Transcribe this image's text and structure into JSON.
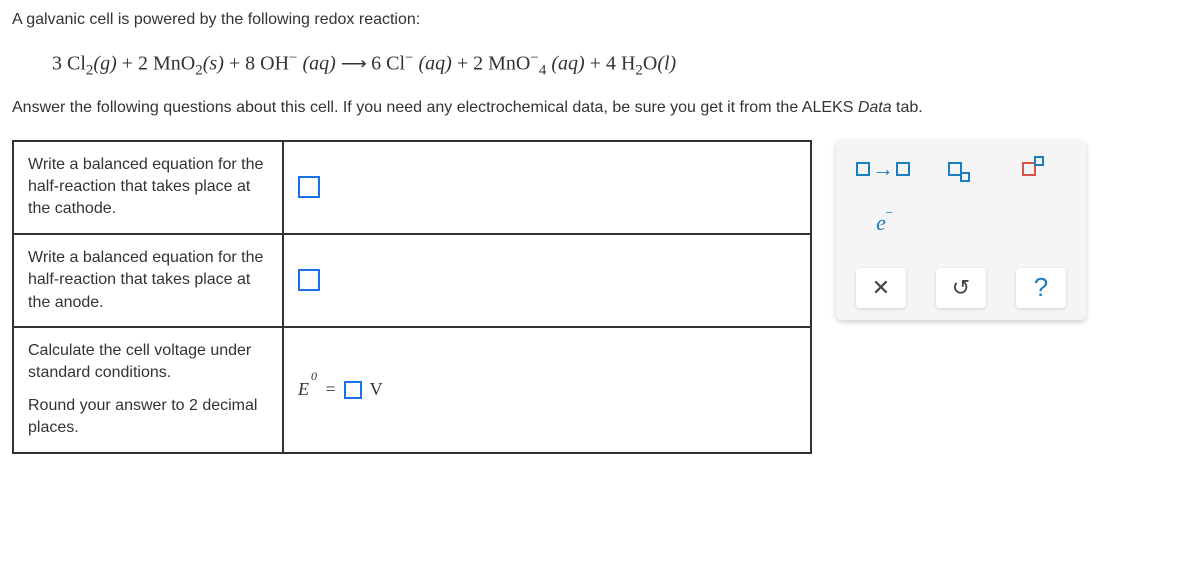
{
  "intro": "A galvanic cell is powered by the following redox reaction:",
  "instructions_before_italic": "Answer the following questions about this cell. If you need any electrochemical data, be sure you get it from the ALEKS ",
  "instructions_italic": "Data",
  "instructions_after_italic": " tab.",
  "equation": {
    "r1_coef": "3",
    "r1": "Cl",
    "r1_sub": "2",
    "r1_state": "(g)",
    "plus1": " + ",
    "r2_coef": "2",
    "r2": "MnO",
    "r2_sub": "2",
    "r2_state": "(s)",
    "plus2": " + ",
    "r3_coef": "8",
    "r3": "OH",
    "r3_sup": "−",
    "r3_state": "(aq)",
    "arrow": " ⟶ ",
    "p1_coef": "6",
    "p1": "Cl",
    "p1_sup": "−",
    "p1_state": "(aq)",
    "plus3": " + ",
    "p2_coef": "2",
    "p2": "MnO",
    "p2_sub": "4",
    "p2_sup": "−",
    "p2_state": "(aq)",
    "plus4": " + ",
    "p3_coef": "4",
    "p3": "H",
    "p3_sub": "2",
    "p3b": "O",
    "p3_state": "(l)"
  },
  "questions": {
    "q1": "Write a balanced equation for the half-reaction that takes place at the cathode.",
    "q2": "Write a balanced equation for the half-reaction that takes place at the anode.",
    "q3a": "Calculate the cell voltage under standard conditions.",
    "q3b": "Round your answer to 2 decimal places.",
    "voltage": {
      "E": "E",
      "sup": "0",
      "equals": "=",
      "unit": "V"
    }
  },
  "toolbox": {
    "electron": "e",
    "minus": "−",
    "close": "✕",
    "reset": "↺",
    "help": "?"
  }
}
